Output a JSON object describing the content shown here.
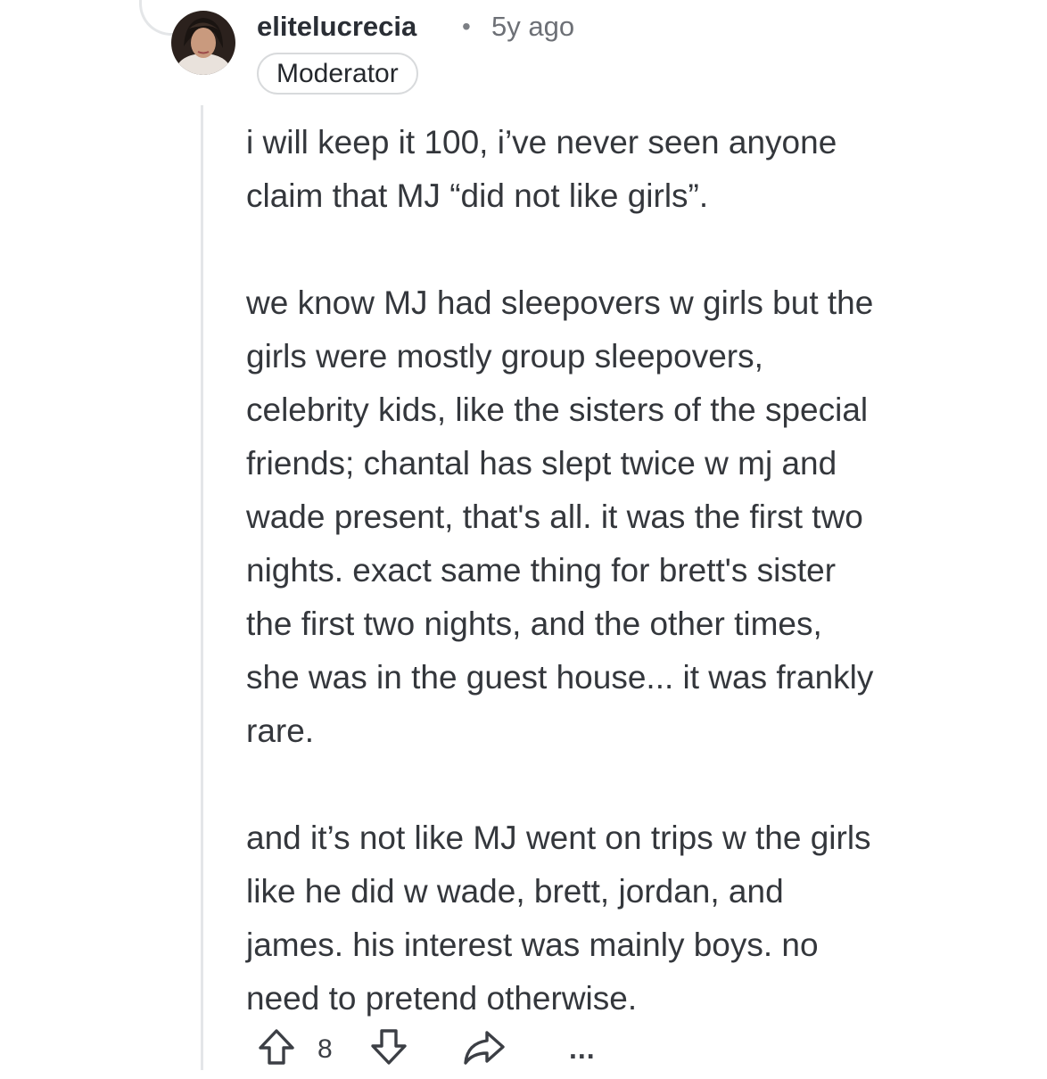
{
  "comment": {
    "author": "elitelucrecia",
    "separator": "•",
    "time": "5y ago",
    "badge": "Moderator",
    "paragraphs": [
      "i will keep it 100, i’ve never seen anyone\nclaim that MJ “did not like girls”.",
      "we know MJ had sleepovers w girls but the\ngirls were mostly group sleepovers,\ncelebrity kids, like the sisters of the special\nfriends; chantal has slept twice w mj and\nwade present, that's all. it was the first two\nnights. exact same thing for brett's sister\nthe first two nights, and the other times,\nshe was in the guest house... it was frankly\nrare.",
      "and it’s not like MJ went on trips w the girls\nlike he did w wade, brett, jordan, and\njames. his interest was mainly boys. no\nneed to pretend otherwise."
    ]
  },
  "actions": {
    "vote_count": "8",
    "upvote_icon": "upvote-arrow-icon",
    "downvote_icon": "downvote-arrow-icon",
    "share_icon": "share-arrow-icon",
    "more_icon": "more-options-icon",
    "more_label": "..."
  },
  "colors": {
    "text": "#34373c",
    "muted": "#6d7076",
    "thread_line": "#e4e6e8"
  }
}
